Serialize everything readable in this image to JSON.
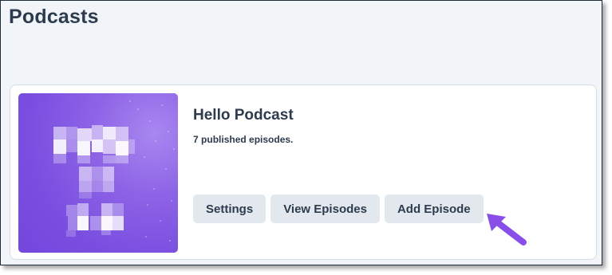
{
  "page": {
    "title": "Podcasts"
  },
  "podcast": {
    "title": "Hello Podcast",
    "episode_count": "7",
    "episode_suffix": "published episodes."
  },
  "actions": {
    "settings": "Settings",
    "view_episodes": "View Episodes",
    "add_episode": "Add Episode"
  },
  "colors": {
    "accent": "#8a4ee8",
    "cover": "#7a4ee0",
    "button_bg": "#e3e8ef",
    "text": "#2d3b4e"
  },
  "icons": {
    "pointer": "arrow-pointer-icon"
  }
}
